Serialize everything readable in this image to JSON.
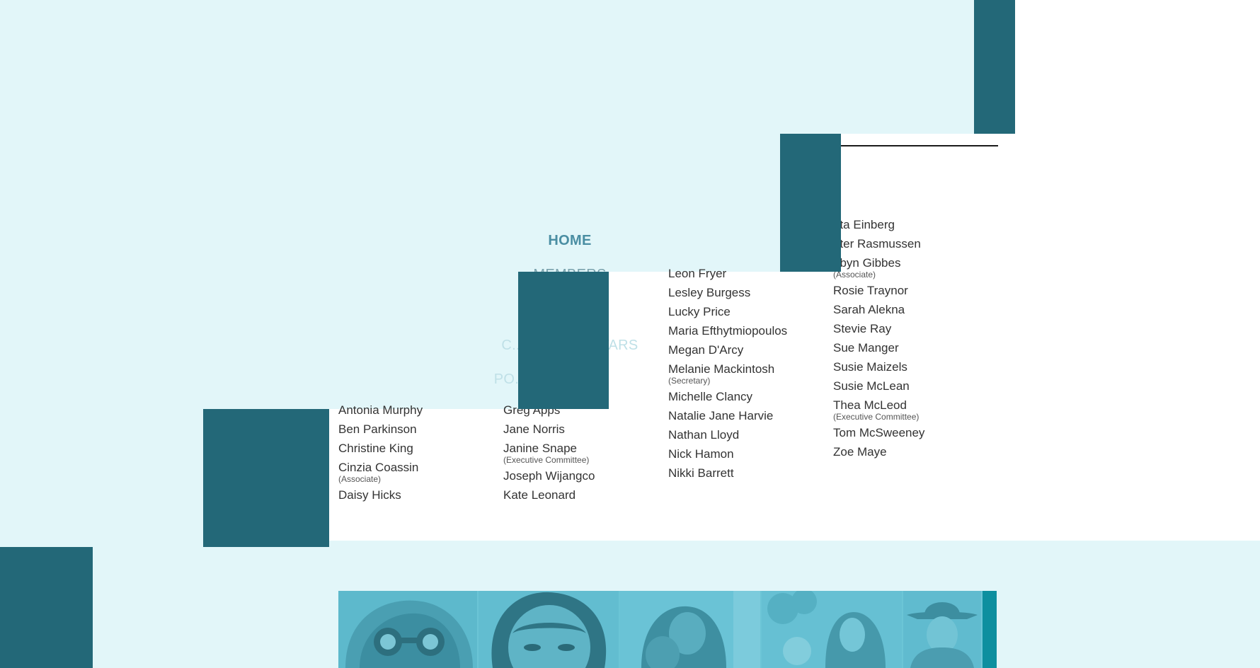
{
  "nav": {
    "home": "HOME",
    "members": "MEMBERS",
    "rising": "C...  / RISING STARS",
    "resources": "PO...OURCES"
  },
  "members": {
    "col1": [
      {
        "name": "Antonia Murphy"
      },
      {
        "name": "Ben Parkinson"
      },
      {
        "name": "Christine King"
      },
      {
        "name": "Cinzia Coassin",
        "note": "(Associate)"
      },
      {
        "name": "Daisy Hicks"
      }
    ],
    "col2": [
      {
        "name": "Greg Apps"
      },
      {
        "name": "Jane Norris"
      },
      {
        "name": "Janine Snape",
        "note": "(Executive Committee)"
      },
      {
        "name": "Joseph Wijangco"
      },
      {
        "name": "Kate Leonard"
      }
    ],
    "col3": [
      {
        "name": "Leon Fryer"
      },
      {
        "name": "Lesley Burgess"
      },
      {
        "name": "Lucky Price"
      },
      {
        "name": "Maria Efthytmiopoulos"
      },
      {
        "name": "Megan D'Arcy"
      },
      {
        "name": "Melanie Mackintosh",
        "note": "(Secretary)"
      },
      {
        "name": "Michelle Clancy"
      },
      {
        "name": "Natalie Jane Harvie"
      },
      {
        "name": "Nathan Lloyd"
      },
      {
        "name": "Nick Hamon"
      },
      {
        "name": "Nikki Barrett"
      }
    ],
    "col4": [
      {
        "name": "eta Einberg"
      },
      {
        "name": "eter Rasmussen"
      },
      {
        "name": "obyn Gibbes",
        "note": "(Associate)"
      },
      {
        "name": "Rosie Traynor"
      },
      {
        "name": "Sarah Alekna"
      },
      {
        "name": "Stevie Ray"
      },
      {
        "name": "Sue Manger"
      },
      {
        "name": "Susie Maizels"
      },
      {
        "name": "Susie McLean"
      },
      {
        "name": "Thea McLeod",
        "note": "(Executive Committee)"
      },
      {
        "name": "Tom McSweeney"
      },
      {
        "name": "Zoe Maye"
      }
    ]
  },
  "colors": {
    "background": "#e2f6f9",
    "teal": "#236878",
    "photo_tint": "#57b8cc",
    "photo_end": "#0d8f9f"
  }
}
